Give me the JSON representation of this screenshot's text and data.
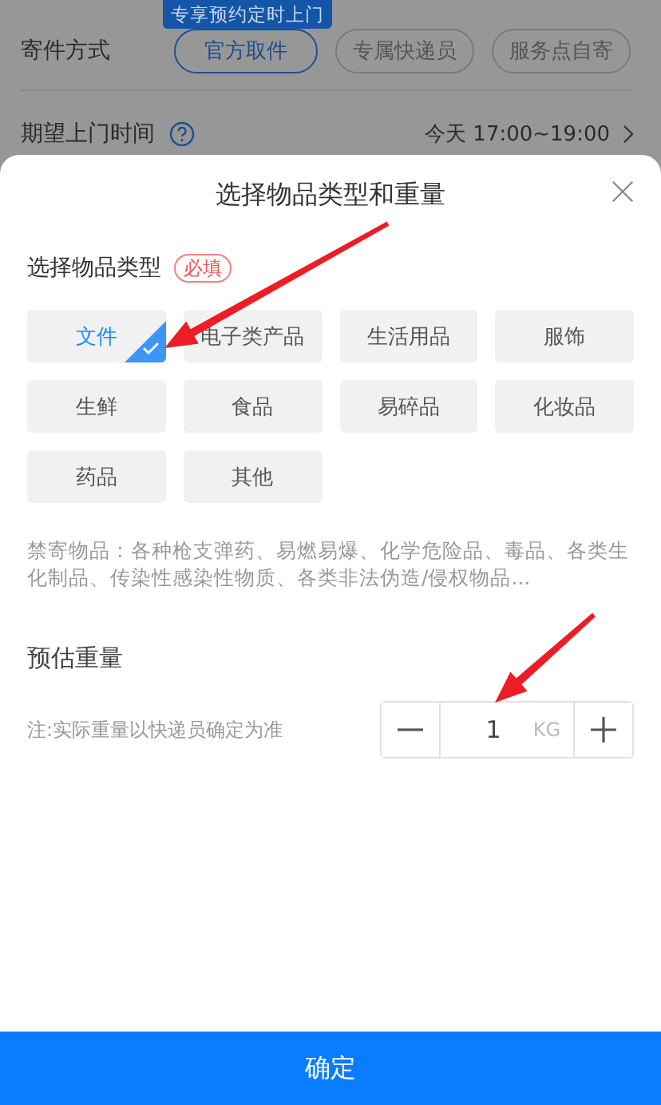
{
  "background_page": {
    "tooltip": "专享预约定时上门",
    "send_method": {
      "label": "寄件方式",
      "options": [
        {
          "label": "官方取件",
          "selected": true
        },
        {
          "label": "专属快递员",
          "selected": false
        },
        {
          "label": "服务点自寄",
          "selected": false
        }
      ]
    },
    "pickup_time": {
      "label": "期望上门时间",
      "value": "今天 17:00~19:00"
    }
  },
  "sheet": {
    "title": "选择物品类型和重量",
    "type_section": {
      "label": "选择物品类型",
      "badge": "必填",
      "types": [
        {
          "label": "文件",
          "selected": true
        },
        {
          "label": "电子类产品",
          "selected": false
        },
        {
          "label": "生活用品",
          "selected": false
        },
        {
          "label": "服饰",
          "selected": false
        },
        {
          "label": "生鲜",
          "selected": false
        },
        {
          "label": "食品",
          "selected": false
        },
        {
          "label": "易碎品",
          "selected": false
        },
        {
          "label": "化妆品",
          "selected": false
        },
        {
          "label": "药品",
          "selected": false
        },
        {
          "label": "其他",
          "selected": false
        }
      ]
    },
    "prohibited_note": "禁寄物品：各种枪支弹药、易燃易爆、化学危险品、毒品、各类生化制品、传染性感染性物质、各类非法伪造/侵权物品...",
    "weight": {
      "label": "预估重量",
      "note": "注:实际重量以快递员确定为准",
      "value": "1",
      "unit": "KG"
    },
    "confirm_button": "确定"
  }
}
